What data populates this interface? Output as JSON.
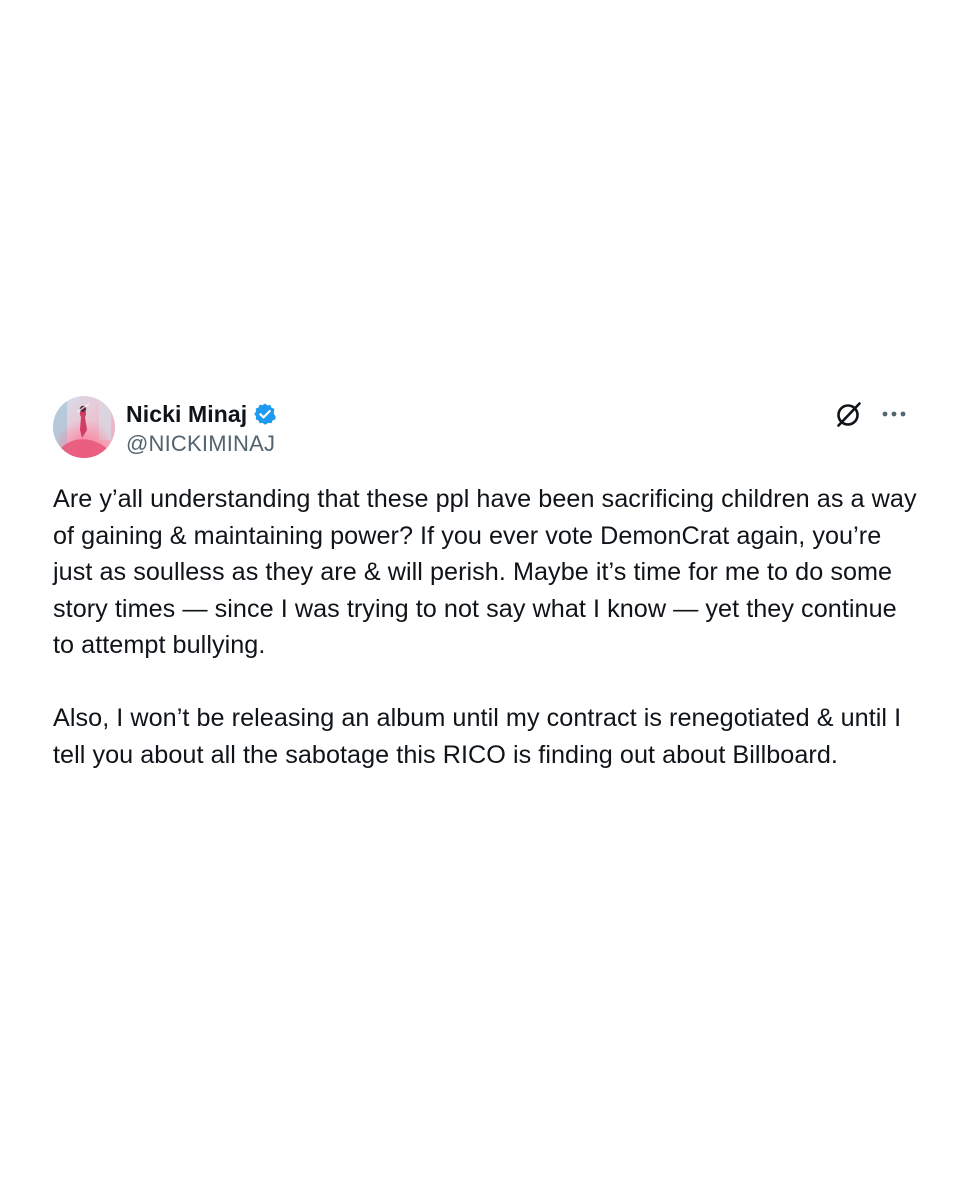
{
  "tweet": {
    "author": {
      "display_name": "Nicki Minaj",
      "handle": "@NICKIMINAJ",
      "verified": true,
      "avatar_icon": "profile-photo",
      "verified_color": "#1d9bf0"
    },
    "actions": {
      "grok_icon": "grok-icon",
      "more_icon": "more-horizontal-icon"
    },
    "paragraphs": [
      "Are y’all understanding that these ppl have been sacrificing children as a way of gaining & maintaining power? If you ever vote DemonCrat again, you’re just as soulless as they are & will perish. Maybe it’s time for me to do some story times — since I was trying to not say what I know — yet they continue to attempt bullying.",
      "Also, I won’t be releasing an album until my contract is renegotiated & until I tell you about all the sabotage this RICO is finding out about Billboard."
    ]
  }
}
